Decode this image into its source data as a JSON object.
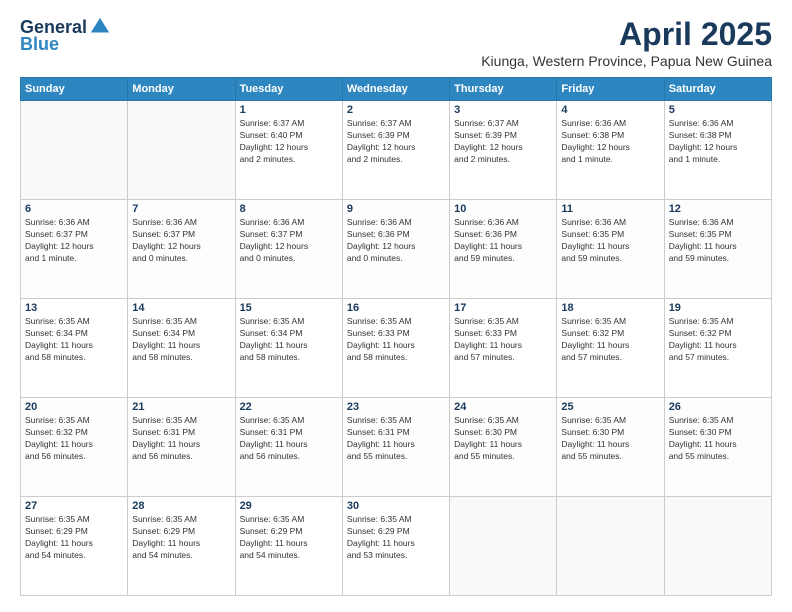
{
  "logo": {
    "general": "General",
    "blue": "Blue"
  },
  "title": {
    "month_year": "April 2025",
    "location": "Kiunga, Western Province, Papua New Guinea"
  },
  "days_of_week": [
    "Sunday",
    "Monday",
    "Tuesday",
    "Wednesday",
    "Thursday",
    "Friday",
    "Saturday"
  ],
  "weeks": [
    [
      {
        "day": "",
        "info": ""
      },
      {
        "day": "",
        "info": ""
      },
      {
        "day": "1",
        "info": "Sunrise: 6:37 AM\nSunset: 6:40 PM\nDaylight: 12 hours\nand 2 minutes."
      },
      {
        "day": "2",
        "info": "Sunrise: 6:37 AM\nSunset: 6:39 PM\nDaylight: 12 hours\nand 2 minutes."
      },
      {
        "day": "3",
        "info": "Sunrise: 6:37 AM\nSunset: 6:39 PM\nDaylight: 12 hours\nand 2 minutes."
      },
      {
        "day": "4",
        "info": "Sunrise: 6:36 AM\nSunset: 6:38 PM\nDaylight: 12 hours\nand 1 minute."
      },
      {
        "day": "5",
        "info": "Sunrise: 6:36 AM\nSunset: 6:38 PM\nDaylight: 12 hours\nand 1 minute."
      }
    ],
    [
      {
        "day": "6",
        "info": "Sunrise: 6:36 AM\nSunset: 6:37 PM\nDaylight: 12 hours\nand 1 minute."
      },
      {
        "day": "7",
        "info": "Sunrise: 6:36 AM\nSunset: 6:37 PM\nDaylight: 12 hours\nand 0 minutes."
      },
      {
        "day": "8",
        "info": "Sunrise: 6:36 AM\nSunset: 6:37 PM\nDaylight: 12 hours\nand 0 minutes."
      },
      {
        "day": "9",
        "info": "Sunrise: 6:36 AM\nSunset: 6:36 PM\nDaylight: 12 hours\nand 0 minutes."
      },
      {
        "day": "10",
        "info": "Sunrise: 6:36 AM\nSunset: 6:36 PM\nDaylight: 11 hours\nand 59 minutes."
      },
      {
        "day": "11",
        "info": "Sunrise: 6:36 AM\nSunset: 6:35 PM\nDaylight: 11 hours\nand 59 minutes."
      },
      {
        "day": "12",
        "info": "Sunrise: 6:36 AM\nSunset: 6:35 PM\nDaylight: 11 hours\nand 59 minutes."
      }
    ],
    [
      {
        "day": "13",
        "info": "Sunrise: 6:35 AM\nSunset: 6:34 PM\nDaylight: 11 hours\nand 58 minutes."
      },
      {
        "day": "14",
        "info": "Sunrise: 6:35 AM\nSunset: 6:34 PM\nDaylight: 11 hours\nand 58 minutes."
      },
      {
        "day": "15",
        "info": "Sunrise: 6:35 AM\nSunset: 6:34 PM\nDaylight: 11 hours\nand 58 minutes."
      },
      {
        "day": "16",
        "info": "Sunrise: 6:35 AM\nSunset: 6:33 PM\nDaylight: 11 hours\nand 58 minutes."
      },
      {
        "day": "17",
        "info": "Sunrise: 6:35 AM\nSunset: 6:33 PM\nDaylight: 11 hours\nand 57 minutes."
      },
      {
        "day": "18",
        "info": "Sunrise: 6:35 AM\nSunset: 6:32 PM\nDaylight: 11 hours\nand 57 minutes."
      },
      {
        "day": "19",
        "info": "Sunrise: 6:35 AM\nSunset: 6:32 PM\nDaylight: 11 hours\nand 57 minutes."
      }
    ],
    [
      {
        "day": "20",
        "info": "Sunrise: 6:35 AM\nSunset: 6:32 PM\nDaylight: 11 hours\nand 56 minutes."
      },
      {
        "day": "21",
        "info": "Sunrise: 6:35 AM\nSunset: 6:31 PM\nDaylight: 11 hours\nand 56 minutes."
      },
      {
        "day": "22",
        "info": "Sunrise: 6:35 AM\nSunset: 6:31 PM\nDaylight: 11 hours\nand 56 minutes."
      },
      {
        "day": "23",
        "info": "Sunrise: 6:35 AM\nSunset: 6:31 PM\nDaylight: 11 hours\nand 55 minutes."
      },
      {
        "day": "24",
        "info": "Sunrise: 6:35 AM\nSunset: 6:30 PM\nDaylight: 11 hours\nand 55 minutes."
      },
      {
        "day": "25",
        "info": "Sunrise: 6:35 AM\nSunset: 6:30 PM\nDaylight: 11 hours\nand 55 minutes."
      },
      {
        "day": "26",
        "info": "Sunrise: 6:35 AM\nSunset: 6:30 PM\nDaylight: 11 hours\nand 55 minutes."
      }
    ],
    [
      {
        "day": "27",
        "info": "Sunrise: 6:35 AM\nSunset: 6:29 PM\nDaylight: 11 hours\nand 54 minutes."
      },
      {
        "day": "28",
        "info": "Sunrise: 6:35 AM\nSunset: 6:29 PM\nDaylight: 11 hours\nand 54 minutes."
      },
      {
        "day": "29",
        "info": "Sunrise: 6:35 AM\nSunset: 6:29 PM\nDaylight: 11 hours\nand 54 minutes."
      },
      {
        "day": "30",
        "info": "Sunrise: 6:35 AM\nSunset: 6:29 PM\nDaylight: 11 hours\nand 53 minutes."
      },
      {
        "day": "",
        "info": ""
      },
      {
        "day": "",
        "info": ""
      },
      {
        "day": "",
        "info": ""
      }
    ]
  ]
}
